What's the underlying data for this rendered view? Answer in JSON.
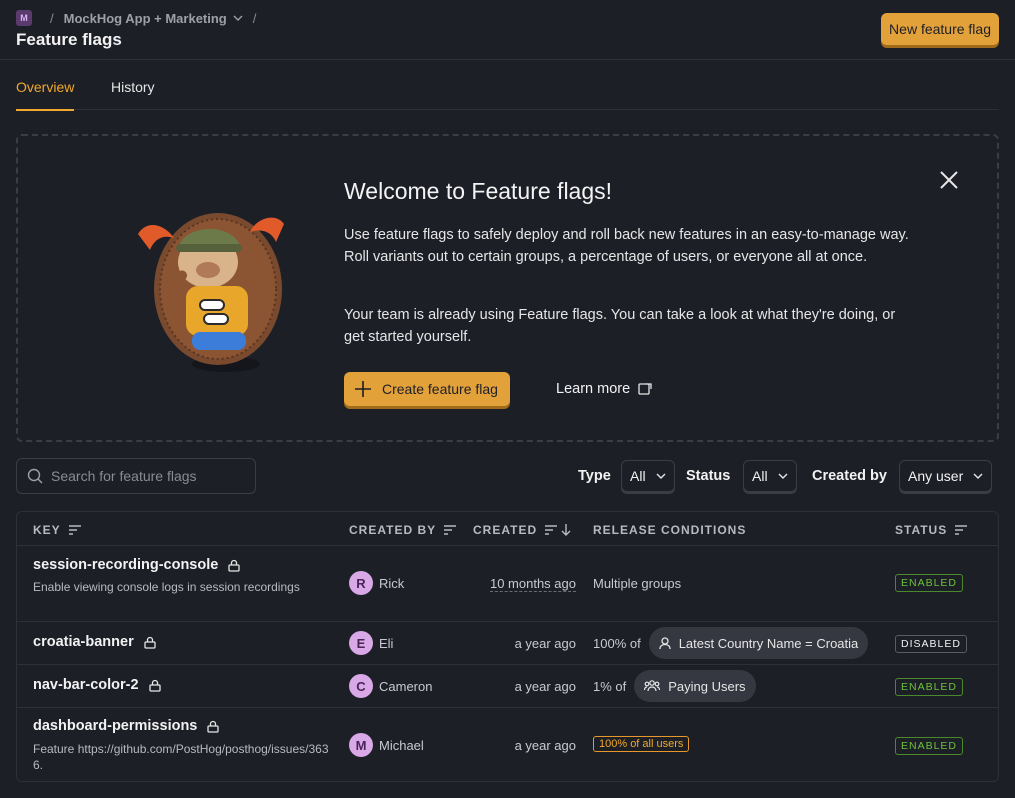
{
  "breadcrumb": {
    "project_initial": "M",
    "project_name": "MockHog App + Marketing",
    "separator": "/"
  },
  "page": {
    "title": "Feature flags",
    "new_button": "New feature flag"
  },
  "tabs": [
    {
      "label": "Overview",
      "active": true
    },
    {
      "label": "History",
      "active": false
    }
  ],
  "welcome": {
    "title": "Welcome to Feature flags!",
    "p1": "Use feature flags to safely deploy and roll back new features in an easy-to-manage way. Roll variants out to certain groups, a percentage of users, or everyone all at once.",
    "p2": "Your team is already using Feature flags. You can take a look at what they're doing, or get started yourself.",
    "create_button": "Create feature flag",
    "learn_more": "Learn more"
  },
  "filters": {
    "search_placeholder": "Search for feature flags",
    "type_label": "Type",
    "type_value": "All",
    "status_label": "Status",
    "status_value": "All",
    "created_by_label": "Created by",
    "created_by_value": "Any user"
  },
  "table": {
    "headers": {
      "key": "KEY",
      "created_by": "CREATED BY",
      "created": "CREATED",
      "release": "RELEASE CONDITIONS",
      "status": "STATUS"
    },
    "rows": [
      {
        "key": "session-recording-console",
        "description": "Enable viewing console logs in session recordings",
        "user_initial": "R",
        "user": "Rick",
        "created": "10 months ago",
        "release": "Multiple groups",
        "status": "ENABLED"
      },
      {
        "key": "croatia-banner",
        "description": "",
        "user_initial": "E",
        "user": "Eli",
        "created": "a year ago",
        "release_pct": "100% of",
        "release_pill": "Latest Country Name = Croatia",
        "status": "DISABLED"
      },
      {
        "key": "nav-bar-color-2",
        "description": "",
        "user_initial": "C",
        "user": "Cameron",
        "created": "a year ago",
        "release_pct": "1% of",
        "release_pill": "Paying Users",
        "status": "ENABLED"
      },
      {
        "key": "dashboard-permissions",
        "description": "Feature https://github.com/PostHog/posthog/issues/3636.",
        "user_initial": "M",
        "user": "Michael",
        "created": "a year ago",
        "release_tag": "100% of all users",
        "status": "ENABLED"
      }
    ]
  },
  "colors": {
    "accent": "#f1a82c",
    "primary_button": "#e3a13a",
    "enabled": "#6cc23a",
    "background": "#1d1f27"
  }
}
